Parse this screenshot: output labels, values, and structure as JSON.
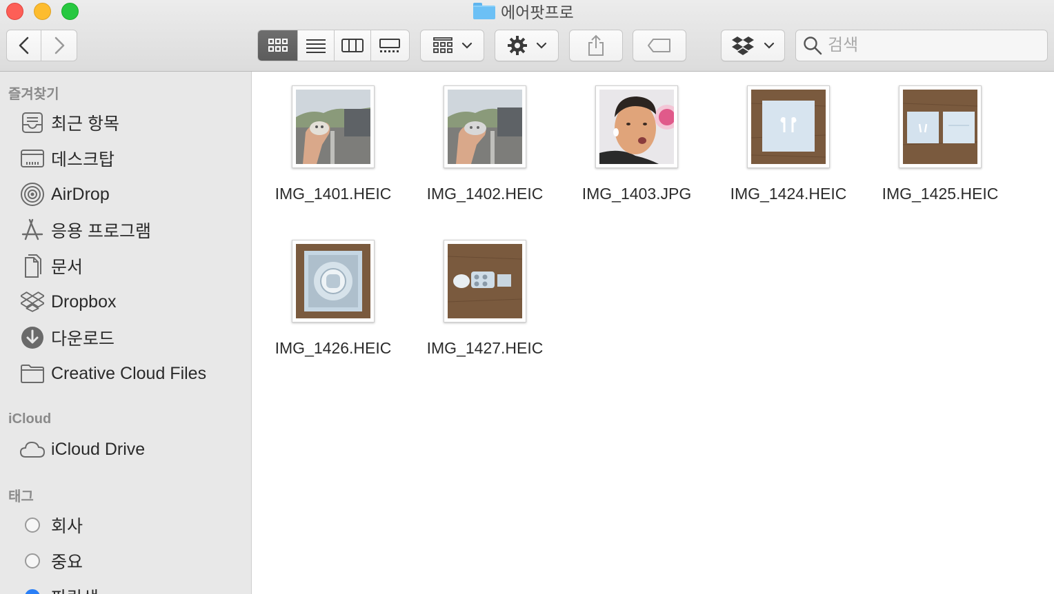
{
  "window": {
    "title": "에어팟프로"
  },
  "toolbar": {
    "back_icon": "chevron-left-icon",
    "forward_icon": "chevron-right-icon",
    "view_modes": [
      "icon-view",
      "list-view",
      "column-view",
      "gallery-view"
    ],
    "active_view": "icon-view",
    "group_icon": "group-grid-icon",
    "action_icon": "gear-icon",
    "share_icon": "share-icon",
    "tag_icon": "tag-icon",
    "dropbox_icon": "dropbox-icon",
    "search_placeholder": "검색"
  },
  "sidebar": {
    "favorites_title": "즐겨찾기",
    "favorites": [
      {
        "label": "최근 항목",
        "icon": "recents-icon"
      },
      {
        "label": "데스크탑",
        "icon": "desktop-icon"
      },
      {
        "label": "AirDrop",
        "icon": "airdrop-icon"
      },
      {
        "label": "응용 프로그램",
        "icon": "applications-icon"
      },
      {
        "label": "문서",
        "icon": "documents-icon"
      },
      {
        "label": "Dropbox",
        "icon": "dropbox-icon"
      },
      {
        "label": "다운로드",
        "icon": "downloads-icon"
      },
      {
        "label": "Creative Cloud Files",
        "icon": "folder-icon"
      }
    ],
    "icloud_title": "iCloud",
    "icloud": [
      {
        "label": "iCloud Drive",
        "icon": "cloud-icon"
      }
    ],
    "tags_title": "태그",
    "tags": [
      {
        "label": "회사",
        "color": "#f6f6f6"
      },
      {
        "label": "중요",
        "color": "#f6f6f6"
      },
      {
        "label": "파란색",
        "color": "#2a7ff6"
      }
    ]
  },
  "files": [
    {
      "name": "IMG_1401.HEIC",
      "thumb": "hand-holding-case-street"
    },
    {
      "name": "IMG_1402.HEIC",
      "thumb": "hand-holding-case-street"
    },
    {
      "name": "IMG_1403.JPG",
      "thumb": "man-selfie"
    },
    {
      "name": "IMG_1424.HEIC",
      "thumb": "airpods-box-on-wood"
    },
    {
      "name": "IMG_1425.HEIC",
      "thumb": "airpods-boxes-on-wood"
    },
    {
      "name": "IMG_1426.HEIC",
      "thumb": "open-box-on-wood"
    },
    {
      "name": "IMG_1427.HEIC",
      "thumb": "ear-tips-on-wood"
    }
  ]
}
